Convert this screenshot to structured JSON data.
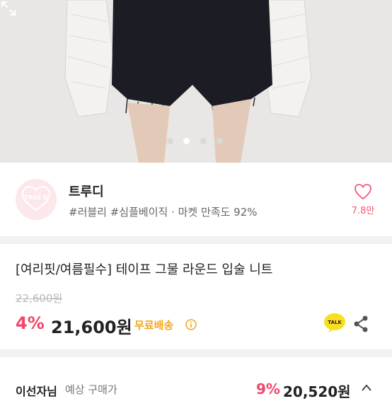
{
  "hero": {
    "image_alt": "product-photo",
    "dots": [
      {
        "active": false
      },
      {
        "active": true
      },
      {
        "active": false
      },
      {
        "active": false
      }
    ]
  },
  "shop": {
    "logo_text": "TRUE D",
    "name": "트루디",
    "tags": "#러블리 #심플베이직 · 마켓 만족도 92%",
    "likes": "7.8만"
  },
  "product": {
    "title": "[여리핏/여름필수] 테이프 그물 라운드 입술 니트",
    "original_price": "22,600원",
    "discount": "4%",
    "price": "21,600원",
    "shipping": "무료배송"
  },
  "bottom": {
    "label": "이선자님",
    "sub": "예상 구매가",
    "discount": "9%",
    "price": "20,520원"
  },
  "colors": {
    "accent_pink": "#f2466a",
    "shipping_orange": "#f2a71a",
    "kakao_yellow": "#f7e022"
  }
}
